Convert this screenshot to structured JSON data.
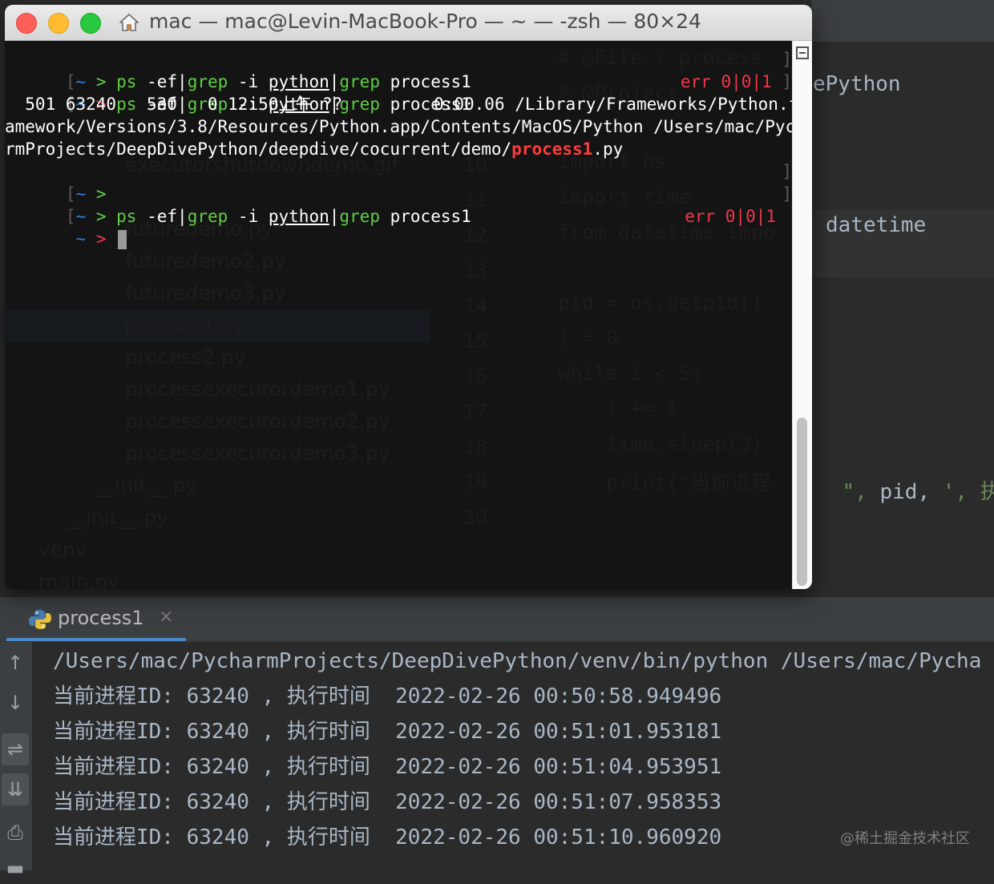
{
  "ide": {
    "code_tail_python": "ePython",
    "code_tail_datetime": "datetime",
    "code_tail_print_str": "\",",
    "code_tail_print_pid": " pid,",
    "code_tail_print_str2": " ', 执行",
    "ghost_files": [
      "executorshutdowndemo.gif",
      "futuredemo.py",
      "futuredemo2.py",
      "futuredemo3.py",
      "process1.py",
      "process2.py",
      "processexecutordemo1.py",
      "processexecutordemo2.py",
      "processexecutordemo3.py",
      "__init__.py",
      "__init__.py",
      "venv",
      "main.py"
    ],
    "ghost_line_numbers": [
      "10",
      "11",
      "12",
      "13",
      "14",
      "15",
      "16",
      "17",
      "18",
      "19",
      "20"
    ],
    "ghost_code": [
      "# @File : process",
      "# @Project",
      "import os",
      "import time",
      "from datetime impo",
      "pid = os.getpid()",
      "i = 0",
      "while i < 5:",
      "    i += 1",
      "    time.sleep(3)",
      "    print(\"当前进程"
    ]
  },
  "terminal": {
    "title": "mac — mac@Levin-MacBook-Pro — ~ — -zsh — 80×24",
    "prompt_open": "[",
    "prompt_tilde": "~",
    "prompt_arrow": ">",
    "prompt_close": "]",
    "cmd_ps": "ps",
    "cmd_flags": "-ef",
    "cmd_pipe": "|",
    "cmd_grep": "grep",
    "cmd_i": "-i",
    "cmd_python": "python",
    "cmd_process": "process1",
    "err_label": "err",
    "err_codes": "0|0|1",
    "output_line1": "  501 63240   530   0 12:50上午 ??         0:00.06 /Library/Frameworks/Python.fr",
    "output_line2": "amework/Versions/3.8/Resources/Python.app/Contents/MacOS/Python /Users/mac/Pycha",
    "output_line3_pre": "rmProjects/DeepDivePython/deepdive/cocurrent/demo/",
    "output_line3_match": "process1",
    "output_line3_post": ".py"
  },
  "run_panel": {
    "tab_label": "process1",
    "tab_close": "×",
    "icons": [
      "arrow-up-icon",
      "arrow-down-icon",
      "soft-wrap-icon",
      "scroll-to-end-icon",
      "print-icon",
      "delete-icon"
    ],
    "console_lines": [
      "/Users/mac/PycharmProjects/DeepDivePython/venv/bin/python /Users/mac/Pycha",
      "当前进程ID: 63240 , 执行时间  2022-02-26 00:50:58.949496",
      "当前进程ID: 63240 , 执行时间  2022-02-26 00:51:01.953181",
      "当前进程ID: 63240 , 执行时间  2022-02-26 00:51:04.953951",
      "当前进程ID: 63240 , 执行时间  2022-02-26 00:51:07.958353",
      "当前进程ID: 63240 , 执行时间  2022-02-26 00:51:10.960920"
    ],
    "watermark": "@稀土掘金技术社区"
  },
  "colors": {
    "ide_bg": "#2b2b2b",
    "terminal_bg": "#141414",
    "prompt_blue": "#2a82d9",
    "command_green": "#5fcf45",
    "error_red": "#f0384c"
  }
}
